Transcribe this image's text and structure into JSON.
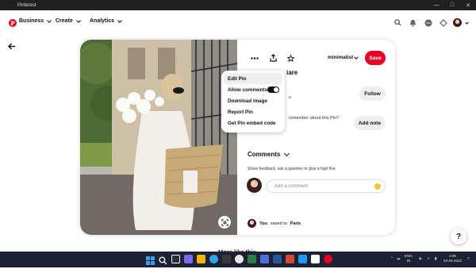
{
  "window": {
    "title": "Pinterest"
  },
  "header": {
    "business_label": "Business",
    "create_label": "Create",
    "analytics_label": "Analytics"
  },
  "pin": {
    "board_name": "minimalist",
    "save_label": "Save",
    "title_fragment": "iare",
    "follow_label": "Follow",
    "remember_text": "remember about this Pin?",
    "add_note_label": "Add note",
    "side_fragment": "s"
  },
  "menu": {
    "items": [
      "Edit Pin",
      "Allow comments",
      "Download image",
      "Report Pin",
      "Get Pin embed code"
    ],
    "allow_comments_on": true
  },
  "comments": {
    "heading": "Comments",
    "subtitle": "Share feedback, ask a question or give a high five",
    "placeholder": "Add a comment"
  },
  "saved": {
    "user": "You",
    "text": "saved to",
    "board": "Paris"
  },
  "more_like_this": "More like this",
  "help_label": "?",
  "tray": {
    "lang_top": "ENG",
    "lang_bottom": "IN",
    "time": "2:05",
    "date": "02-03-2022"
  },
  "colors": {
    "brand": "#e60023",
    "taskbar": "#1c2233"
  }
}
